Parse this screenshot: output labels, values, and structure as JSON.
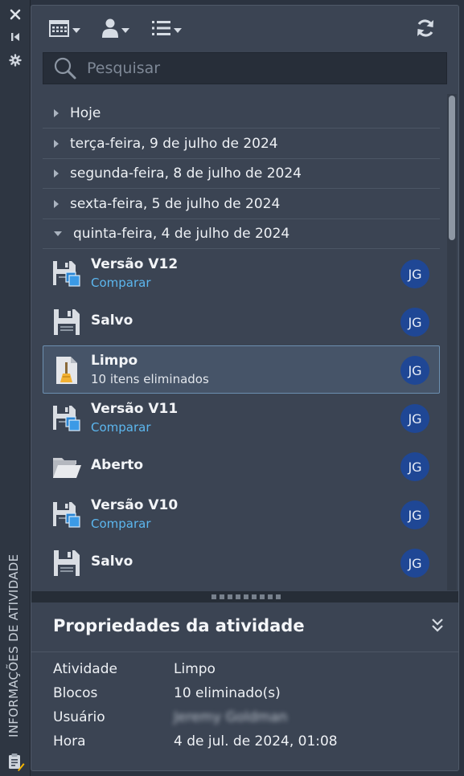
{
  "strip": {
    "title": "INFORMAÇÕES DE ATIVIDADE",
    "icons": [
      "close-icon",
      "collapse-to-edge-icon",
      "gear-icon",
      "clipboard-activity-icon"
    ]
  },
  "toolbar": {
    "icons": [
      "calendar-filter-icon",
      "user-filter-icon",
      "list-view-icon",
      "refresh-icon"
    ]
  },
  "search": {
    "placeholder": "Pesquisar",
    "value": ""
  },
  "date_groups": [
    {
      "label": "Hoje",
      "expanded": false
    },
    {
      "label": "terça-feira, 9 de julho de 2024",
      "expanded": false
    },
    {
      "label": "segunda-feira, 8 de julho de 2024",
      "expanded": false
    },
    {
      "label": "sexta-feira, 5 de julho de 2024",
      "expanded": false
    },
    {
      "label": "quinta-feira, 4 de julho de 2024",
      "expanded": true
    }
  ],
  "activities": [
    {
      "title": "Versão V12",
      "subtitle": "Comparar",
      "subtitle_is_link": true,
      "icon": "save-version-icon",
      "initials": "JG",
      "selected": false
    },
    {
      "title": "Salvo",
      "subtitle": "",
      "subtitle_is_link": false,
      "icon": "save-icon",
      "initials": "JG",
      "selected": false
    },
    {
      "title": "Limpo",
      "subtitle": "10 itens eliminados",
      "subtitle_is_link": false,
      "icon": "purge-document-icon",
      "initials": "JG",
      "selected": true
    },
    {
      "title": "Versão V11",
      "subtitle": "Comparar",
      "subtitle_is_link": true,
      "icon": "save-version-icon",
      "initials": "JG",
      "selected": false
    },
    {
      "title": "Aberto",
      "subtitle": "",
      "subtitle_is_link": false,
      "icon": "open-folder-icon",
      "initials": "JG",
      "selected": false
    },
    {
      "title": "Versão V10",
      "subtitle": "Comparar",
      "subtitle_is_link": true,
      "icon": "save-version-icon",
      "initials": "JG",
      "selected": false
    },
    {
      "title": "Salvo",
      "subtitle": "",
      "subtitle_is_link": false,
      "icon": "save-icon",
      "initials": "JG",
      "selected": false
    }
  ],
  "properties": {
    "title": "Propriedades da atividade",
    "rows": [
      {
        "key": "Atividade",
        "value": "Limpo"
      },
      {
        "key": "Blocos",
        "value": "10 eliminado(s)"
      },
      {
        "key": "Usuário",
        "value": "Jeremy Goldman"
      },
      {
        "key": "Hora",
        "value": "4 de jul. de 2024, 01:08"
      }
    ]
  },
  "colors": {
    "panel_bg": "#3b4453",
    "avatar_bg": "#1f4795",
    "link": "#5cb7ef",
    "selected_bg": "#465468",
    "selected_border": "#6c8fb0"
  }
}
